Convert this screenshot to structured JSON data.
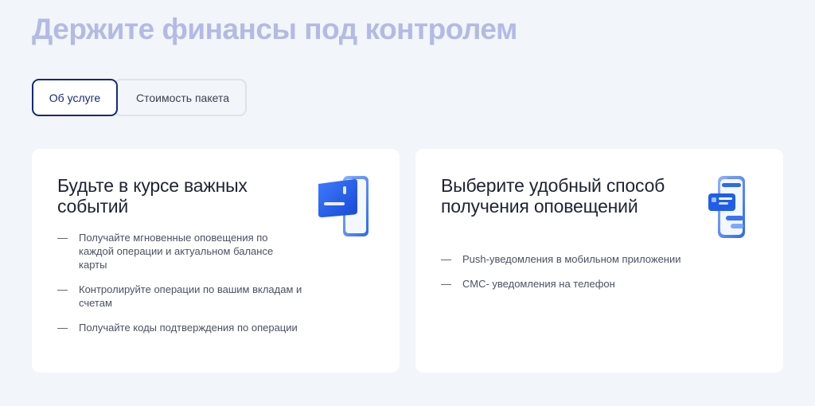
{
  "header": {
    "title": "Держите финансы под контролем"
  },
  "tabs": [
    {
      "label": "Об услуге",
      "active": true
    },
    {
      "label": "Стоимость пакета",
      "active": false
    }
  ],
  "cards": [
    {
      "title": "Будьте в курсе важных событий",
      "icon": "phone-with-card-icon",
      "items": [
        "Получайте мгновенные оповещения по каждой операции и актуальном балансе карты",
        "Контролируйте операции по вашим вкладам и счетам",
        "Получайте коды подтверждения по операции"
      ]
    },
    {
      "title": "Выберите удобный способ получения оповещений",
      "icon": "phone-with-message-icon",
      "items": [
        "Push-уведомления в мобильном приложении",
        "СМС- уведомления на телефон"
      ]
    }
  ],
  "list_marker": "—",
  "colors": {
    "background": "#f2f5f9",
    "title": "#b3bbe3",
    "accent": "#15297a",
    "icon_blue": "#1f5ee8"
  }
}
